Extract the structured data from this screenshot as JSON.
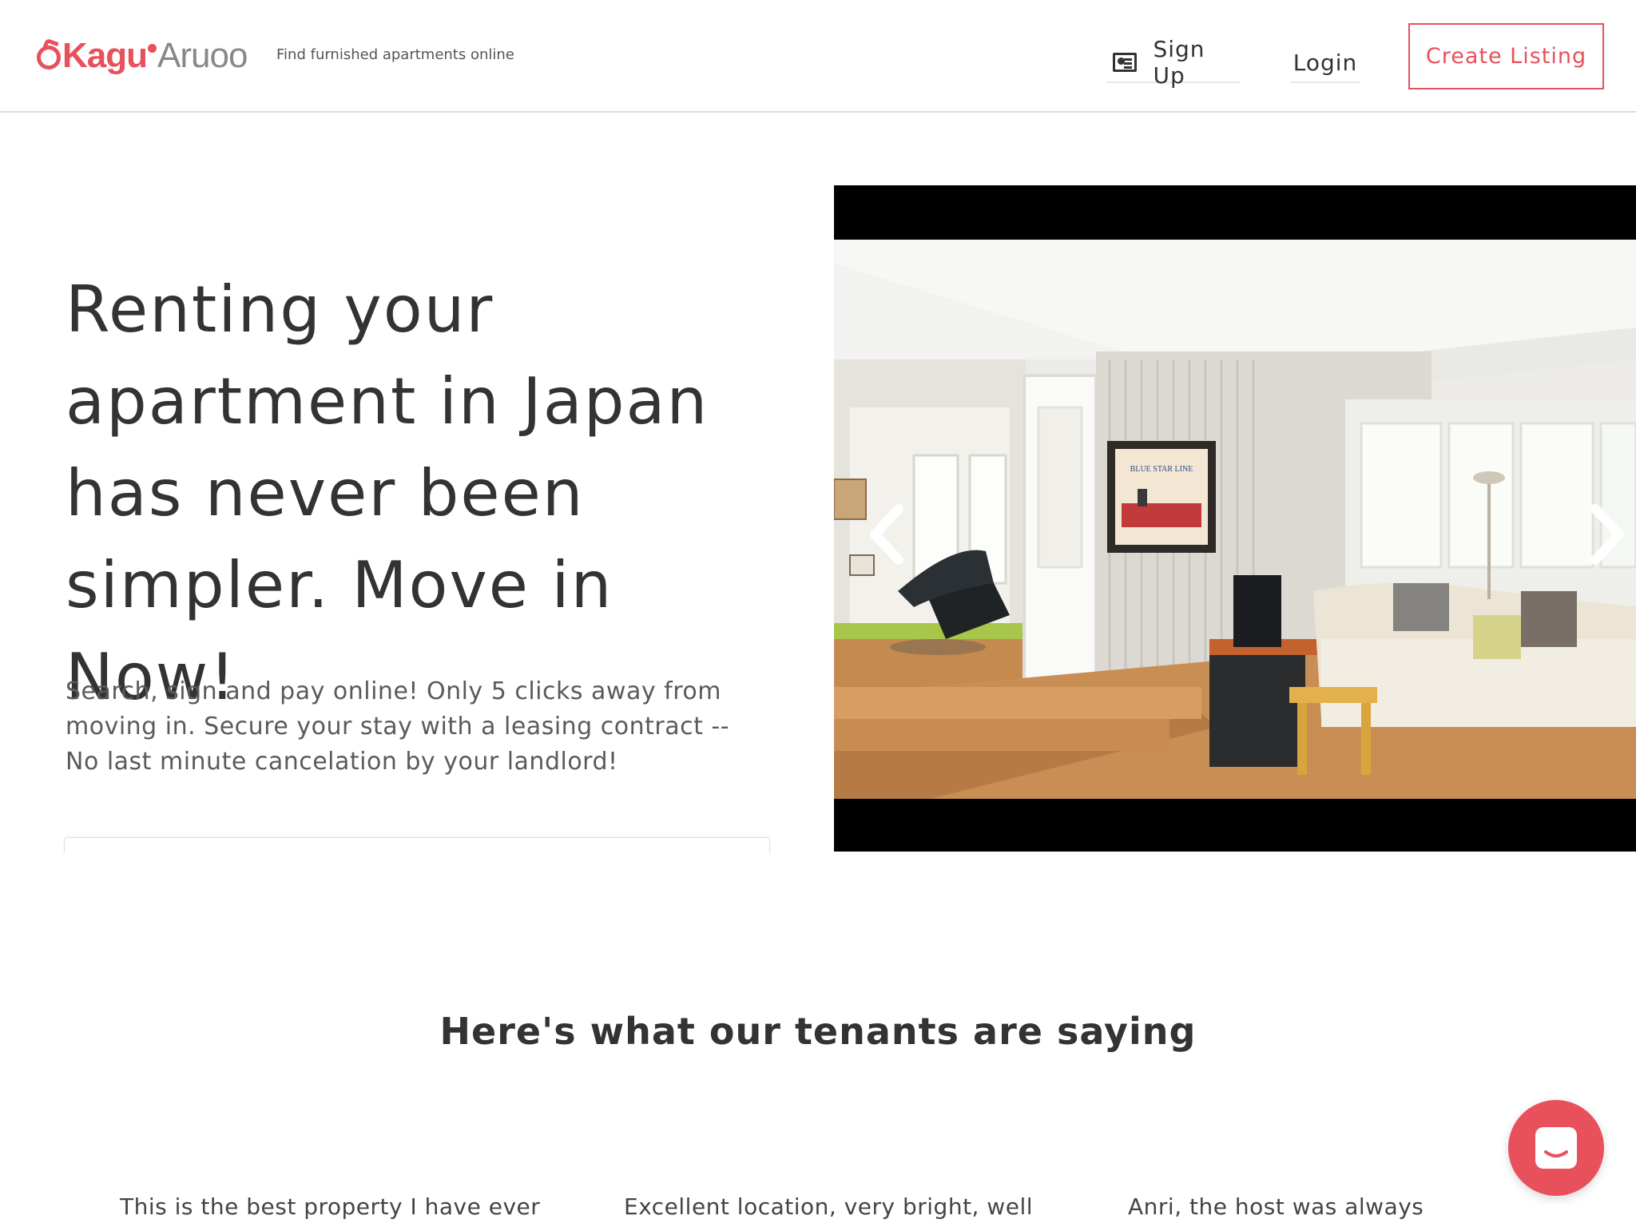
{
  "header": {
    "logo_left": "Kagu",
    "logo_right": "Aruoo",
    "tagline": "Find furnished apartments online",
    "signup_label": "Sign Up",
    "login_label": "Login",
    "create_listing_label": "Create Listing",
    "signup_icon": "id-card-icon"
  },
  "hero": {
    "headline": "Renting your apartment in Japan has never been simpler. Move in Now!",
    "subtext": "Search, sign and pay online! Only 5 clicks away from moving in. Secure your stay with a leasing contract -- No last minute cancelation by your landlord!"
  },
  "carousel": {
    "prev_icon": "chevron-left-icon",
    "next_icon": "chevron-right-icon",
    "painting_caption": "BLUE STAR LINE"
  },
  "testimonials": {
    "title": "Here's what our tenants are saying",
    "items": [
      "This is the best property I have ever",
      "Excellent location, very bright, well",
      "Anri, the host was always"
    ]
  },
  "chat_widget": {
    "icon": "chat-bubble-icon"
  },
  "colors": {
    "brand": "#e8505b",
    "text": "#333333",
    "muted": "#888888"
  }
}
